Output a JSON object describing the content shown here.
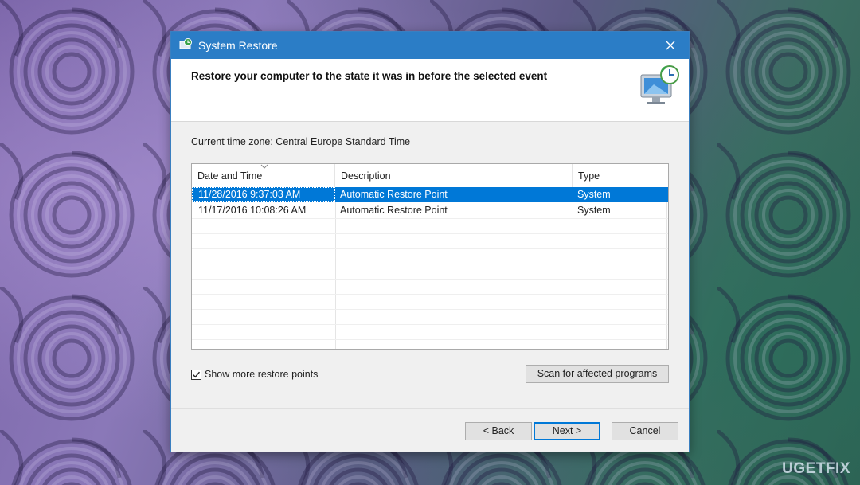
{
  "window": {
    "title": "System Restore",
    "close_glyph": "✕",
    "app_icon": "system-restore-icon",
    "accent_color": "#2b7dc6",
    "selection_color": "#0078d7"
  },
  "header": {
    "heading": "Restore your computer to the state it was in before the selected event",
    "icon": "restore-monitor-icon"
  },
  "timezone_text": "Current time zone: Central Europe Standard Time",
  "table": {
    "columns": [
      "Date and Time",
      "Description",
      "Type"
    ],
    "sorted_column": "Date and Time",
    "rows": [
      {
        "date": "11/28/2016 9:37:03 AM",
        "description": "Automatic Restore Point",
        "type": "System",
        "selected": true
      },
      {
        "date": "11/17/2016 10:08:26 AM",
        "description": "Automatic Restore Point",
        "type": "System",
        "selected": false
      }
    ]
  },
  "show_more": {
    "label": "Show more restore points",
    "checked": true
  },
  "buttons": {
    "scan": "Scan for affected programs",
    "back": "< Back",
    "next": "Next >",
    "cancel": "Cancel"
  },
  "watermark": "UGETFIX"
}
